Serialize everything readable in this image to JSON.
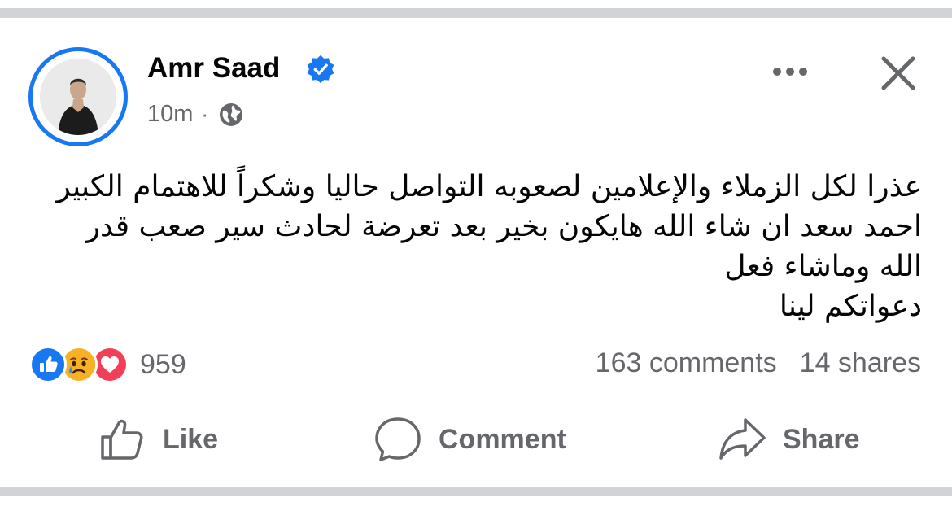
{
  "post": {
    "author": "Amr Saad",
    "time": "10m",
    "separator": "·",
    "text_lines": [
      "عذرا لكل الزملاء والإعلامين لصعوبه التواصل حاليا  وشكراً للاهتمام الكبير",
      "احمد سعد ان شاء الله هايكون بخير بعد تعرضة لحادث سير صعب قدر",
      "الله وماشاء فعل",
      "دعواتكم لينا"
    ]
  },
  "reactions": {
    "icons": [
      "like-icon",
      "sad-icon",
      "love-icon"
    ],
    "count": "959",
    "comments": "163 comments",
    "shares": "14 shares"
  },
  "actions": {
    "like": "Like",
    "comment": "Comment",
    "share": "Share"
  },
  "colors": {
    "brand_blue": "#1877f2",
    "love_red": "#f33e58",
    "muted_text": "#65676b",
    "divider": "#d2d3d6"
  }
}
